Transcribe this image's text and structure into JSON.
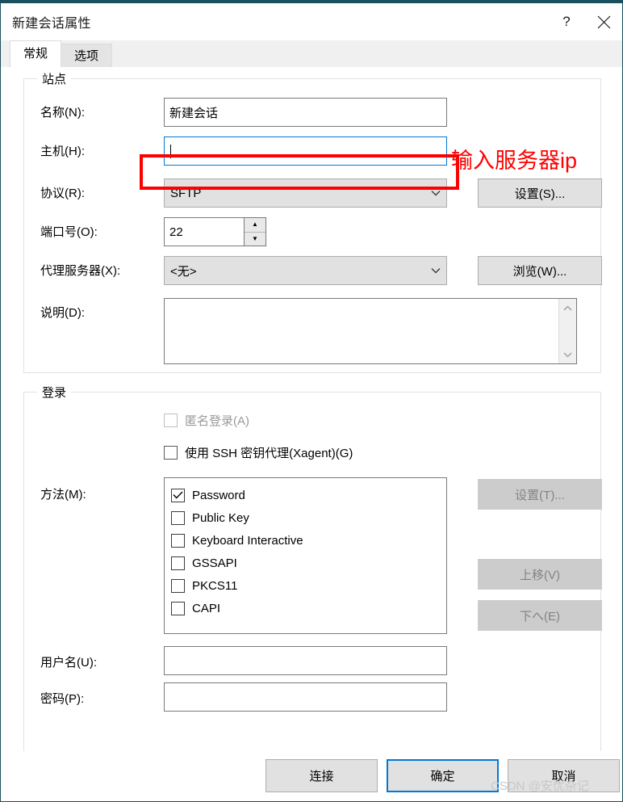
{
  "window": {
    "title": "新建会话属性",
    "help_icon": "question-mark-icon",
    "close_icon": "close-icon",
    "accent_color": "#1b4f5e"
  },
  "tabs": [
    {
      "label": "常规",
      "active": true
    },
    {
      "label": "选项",
      "active": false
    }
  ],
  "site": {
    "legend": "站点",
    "name_label": "名称(N):",
    "name_value": "新建会话",
    "host_label": "主机(H):",
    "host_value": "",
    "protocol_label": "协议(R):",
    "protocol_value": "SFTP",
    "protocol_settings_button": "设置(S)...",
    "port_label": "端口号(O):",
    "port_value": "22",
    "proxy_label": "代理服务器(X):",
    "proxy_value": "<无>",
    "proxy_browse_button": "浏览(W)...",
    "description_label": "说明(D):",
    "description_value": ""
  },
  "login": {
    "legend": "登录",
    "anonymous_label": "匿名登录(A)",
    "anonymous_checked": false,
    "anonymous_disabled": true,
    "xagent_label": "使用 SSH 密钥代理(Xagent)(G)",
    "xagent_checked": false,
    "method_label": "方法(M):",
    "methods": [
      {
        "label": "Password",
        "checked": true
      },
      {
        "label": "Public Key",
        "checked": false
      },
      {
        "label": "Keyboard Interactive",
        "checked": false
      },
      {
        "label": "GSSAPI",
        "checked": false
      },
      {
        "label": "PKCS11",
        "checked": false
      },
      {
        "label": "CAPI",
        "checked": false
      }
    ],
    "method_settings_button": "设置(T)...",
    "move_up_button": "上移(V)",
    "move_down_button": "下へ(E)",
    "username_label": "用户名(U):",
    "username_value": "",
    "password_label": "密码(P):",
    "password_value": ""
  },
  "footer": {
    "connect_button": "连接",
    "ok_button": "确定",
    "cancel_button": "取消"
  },
  "annotation": {
    "text": "输入服务器ip",
    "color": "#ff0000"
  },
  "watermark": {
    "text": "CSDN @安优杂记"
  }
}
